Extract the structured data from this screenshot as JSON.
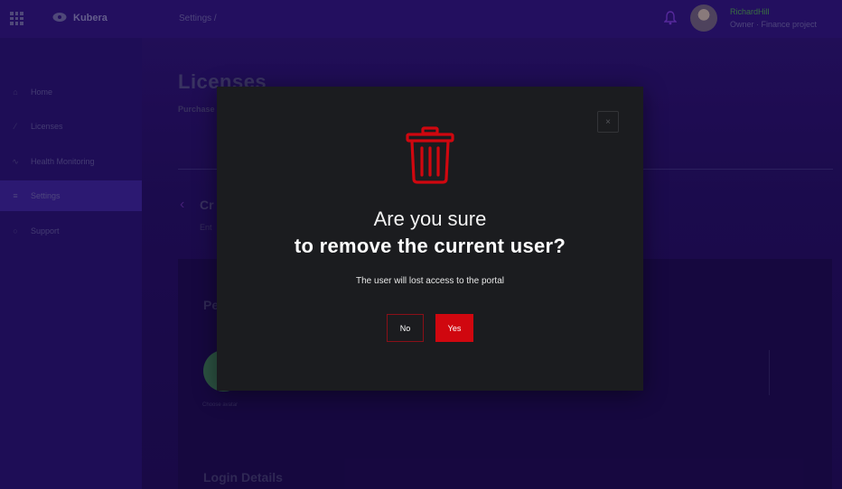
{
  "header": {
    "brand": "Kubera",
    "breadcrumb": "Settings /",
    "user_name": "RichardHill",
    "user_role": "Owner · Finance project"
  },
  "sidebar": {
    "items": [
      {
        "label": "Home",
        "icon": "home-icon"
      },
      {
        "label": "Licenses",
        "icon": "license-icon"
      },
      {
        "label": "Health Monitoring",
        "icon": "pulse-icon"
      },
      {
        "label": "Settings",
        "icon": "settings-icon",
        "active": true
      },
      {
        "label": "Support",
        "icon": "support-icon"
      }
    ]
  },
  "main": {
    "title": "Licenses",
    "subtitle": "Purchase",
    "section_title": "Cr",
    "section_sub": "Ent",
    "panel_title": "Pe",
    "avatar_caption": "Choose avatar",
    "login_title": "Login Details"
  },
  "modal": {
    "close_label": "×",
    "question_line1": "Are you sure",
    "question_line2": "to remove the current user?",
    "message": "The user will lost access to the portal",
    "no_label": "No",
    "yes_label": "Yes"
  },
  "colors": {
    "accent": "#d0070f",
    "modal_bg": "#1b1c1f",
    "page_bg": "#241060"
  }
}
